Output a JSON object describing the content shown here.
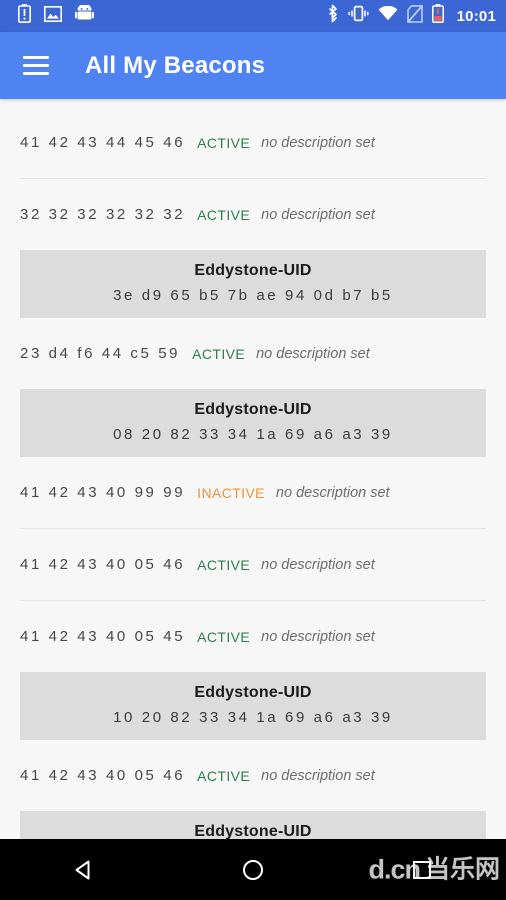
{
  "status_bar": {
    "icons_left": [
      "battery-alert-icon",
      "screenshot-image-icon",
      "android-robot-icon"
    ],
    "icons_right": [
      "bluetooth-icon",
      "vibrate-icon",
      "wifi-icon",
      "no-sim-icon",
      "battery-low-icon"
    ],
    "clock": "10:01",
    "background": "#3b66d4"
  },
  "app_bar": {
    "menu_icon": "hamburger-menu-icon",
    "title": "All My Beacons",
    "background": "#4f83f1"
  },
  "colors": {
    "active": "#2e7d4f",
    "inactive": "#e8953a",
    "card": "#dcdcdc",
    "page": "#f7f7f7",
    "divider": "#e4e4e4"
  },
  "list": {
    "rows": [
      {
        "type": "beacon",
        "address": "41 42 43 44 45 46",
        "state": "ACTIVE",
        "description": "no description set"
      },
      {
        "type": "divider"
      },
      {
        "type": "beacon",
        "address": "32 32 32 32 32 32",
        "state": "ACTIVE",
        "description": "no description set"
      },
      {
        "type": "card",
        "title": "Eddystone-UID",
        "hex": "3e d9 65 b5 7b ae 94 0d b7 b5"
      },
      {
        "type": "beacon",
        "address": "23 d4 f6 44 c5 59",
        "state": "ACTIVE",
        "description": "no description set"
      },
      {
        "type": "card",
        "title": "Eddystone-UID",
        "hex": "08 20 82 33 34 1a 69 a6 a3 39"
      },
      {
        "type": "beacon",
        "address": "41 42 43 40 99 99",
        "state": "INACTIVE",
        "description": "no description set"
      },
      {
        "type": "divider"
      },
      {
        "type": "beacon",
        "address": "41 42 43 40 05 46",
        "state": "ACTIVE",
        "description": "no description set"
      },
      {
        "type": "divider"
      },
      {
        "type": "beacon",
        "address": "41 42 43 40 05 45",
        "state": "ACTIVE",
        "description": "no description set"
      },
      {
        "type": "card",
        "title": "Eddystone-UID",
        "hex": "10 20 82 33 34 1a 69 a6 a3 39"
      },
      {
        "type": "beacon",
        "address": "41 42 43 40 05 46",
        "state": "ACTIVE",
        "description": "no description set"
      },
      {
        "type": "card",
        "title": "Eddystone-UID",
        "hex": ""
      }
    ]
  },
  "nav_bar": {
    "back": "back-triangle-icon",
    "home": "home-circle-icon",
    "recents": "recents-square-icon",
    "watermark_latin": "d.cn",
    "watermark_cn": "当乐网"
  }
}
